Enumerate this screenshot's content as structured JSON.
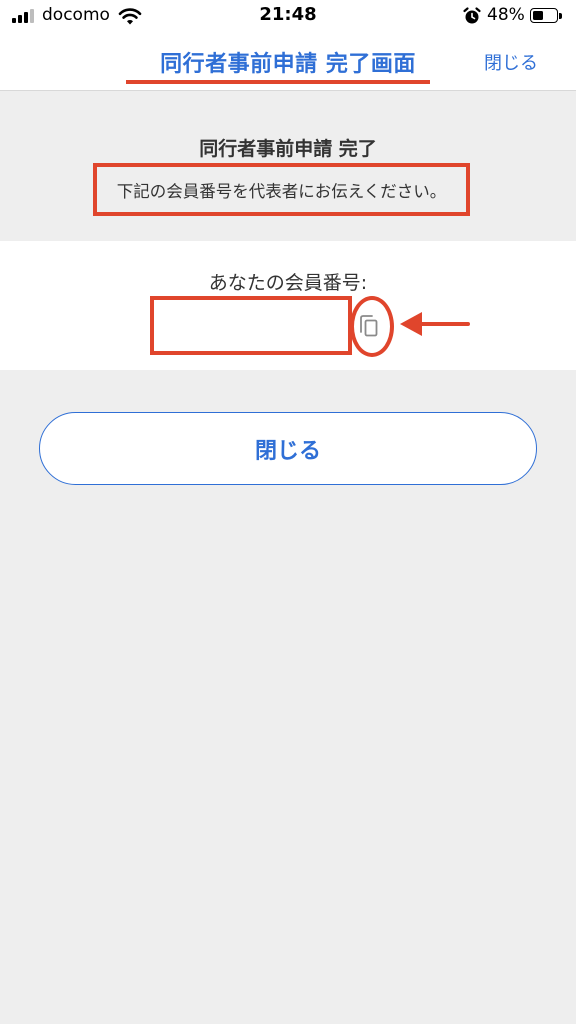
{
  "status_bar": {
    "carrier": "docomo",
    "time": "21:48",
    "battery_percent": "48%",
    "battery_level": 0.48,
    "icons": [
      "signal-icon",
      "wifi-icon",
      "alarm-icon",
      "battery-icon"
    ]
  },
  "nav": {
    "title": "同行者事前申請 完了画面",
    "close_label": "閉じる"
  },
  "main": {
    "complete_title": "同行者事前申請 完了",
    "instruction": "下記の会員番号を代表者にお伝えください。",
    "member_label": "あなたの会員番号:",
    "member_number": "",
    "close_button_label": "閉じる"
  },
  "colors": {
    "accent": "#2f6fd6",
    "highlight": "#e0452c",
    "background": "#eeeeee"
  }
}
